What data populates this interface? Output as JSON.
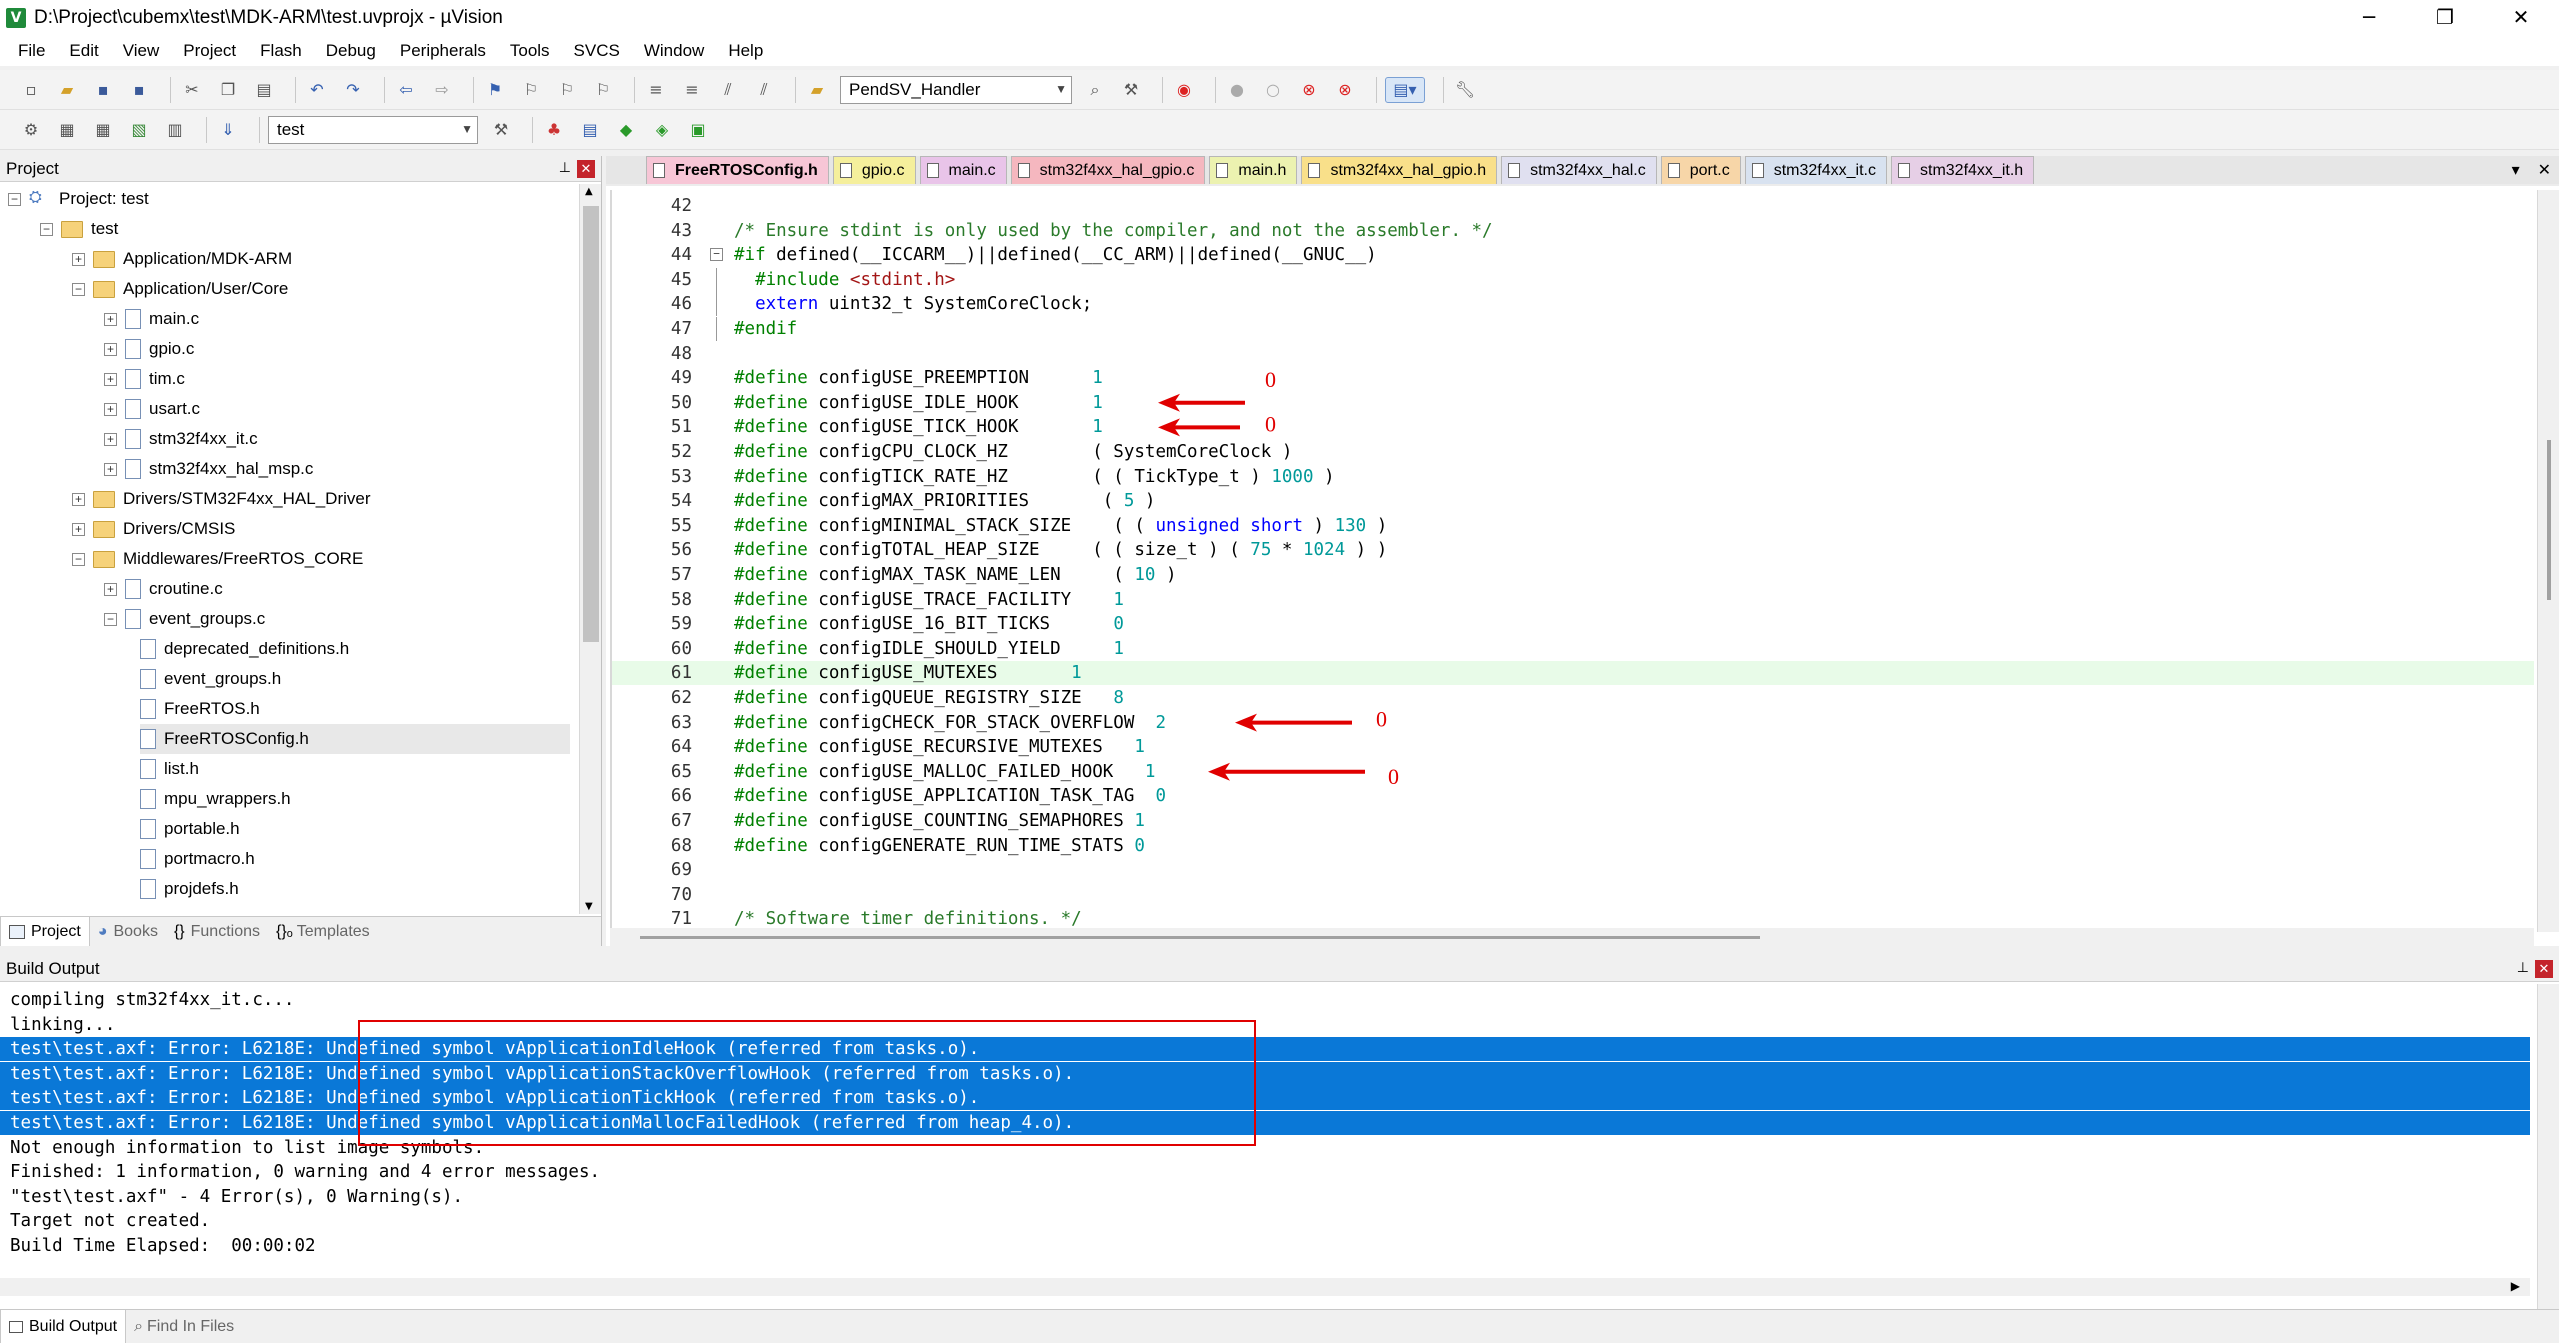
{
  "window": {
    "title": "D:\\Project\\cubemx\\test\\MDK-ARM\\test.uvprojx - µVision",
    "app_icon": "μVision-icon",
    "minimize": "─",
    "maximize": "❐",
    "close": "✕"
  },
  "menu": [
    "File",
    "Edit",
    "View",
    "Project",
    "Flash",
    "Debug",
    "Peripherals",
    "Tools",
    "SVCS",
    "Window",
    "Help"
  ],
  "toolbar1": {
    "function_combo": "PendSV_Handler"
  },
  "toolbar2": {
    "target_combo": "test"
  },
  "project_panel": {
    "title": "Project",
    "pin": "ᵖ",
    "close": "✕",
    "tree": [
      {
        "label": "Project: test",
        "indent": 0,
        "expander": "−",
        "icon": "project"
      },
      {
        "label": "test",
        "indent": 1,
        "expander": "−",
        "icon": "folder"
      },
      {
        "label": "Application/MDK-ARM",
        "indent": 2,
        "expander": "+",
        "icon": "folder"
      },
      {
        "label": "Application/User/Core",
        "indent": 2,
        "expander": "−",
        "icon": "folder"
      },
      {
        "label": "main.c",
        "indent": 3,
        "expander": "+",
        "icon": "file"
      },
      {
        "label": "gpio.c",
        "indent": 3,
        "expander": "+",
        "icon": "file"
      },
      {
        "label": "tim.c",
        "indent": 3,
        "expander": "+",
        "icon": "file"
      },
      {
        "label": "usart.c",
        "indent": 3,
        "expander": "+",
        "icon": "file"
      },
      {
        "label": "stm32f4xx_it.c",
        "indent": 3,
        "expander": "+",
        "icon": "file"
      },
      {
        "label": "stm32f4xx_hal_msp.c",
        "indent": 3,
        "expander": "+",
        "icon": "file"
      },
      {
        "label": "Drivers/STM32F4xx_HAL_Driver",
        "indent": 2,
        "expander": "+",
        "icon": "folder"
      },
      {
        "label": "Drivers/CMSIS",
        "indent": 2,
        "expander": "+",
        "icon": "folder"
      },
      {
        "label": "Middlewares/FreeRTOS_CORE",
        "indent": 2,
        "expander": "−",
        "icon": "folder"
      },
      {
        "label": "croutine.c",
        "indent": 3,
        "expander": "+",
        "icon": "file"
      },
      {
        "label": "event_groups.c",
        "indent": 3,
        "expander": "−",
        "icon": "file"
      },
      {
        "label": "deprecated_definitions.h",
        "indent": 4,
        "expander": "",
        "icon": "file"
      },
      {
        "label": "event_groups.h",
        "indent": 4,
        "expander": "",
        "icon": "file"
      },
      {
        "label": "FreeRTOS.h",
        "indent": 4,
        "expander": "",
        "icon": "file"
      },
      {
        "label": "FreeRTOSConfig.h",
        "indent": 4,
        "expander": "",
        "icon": "file",
        "selected": true
      },
      {
        "label": "list.h",
        "indent": 4,
        "expander": "",
        "icon": "file"
      },
      {
        "label": "mpu_wrappers.h",
        "indent": 4,
        "expander": "",
        "icon": "file"
      },
      {
        "label": "portable.h",
        "indent": 4,
        "expander": "",
        "icon": "file"
      },
      {
        "label": "portmacro.h",
        "indent": 4,
        "expander": "",
        "icon": "file"
      },
      {
        "label": "projdefs.h",
        "indent": 4,
        "expander": "",
        "icon": "file"
      }
    ],
    "tabs": [
      {
        "label": "Project",
        "icon": "project-tab-icon",
        "active": true
      },
      {
        "label": "Books",
        "icon": "books-icon"
      },
      {
        "label": "Functions",
        "icon": "{}"
      },
      {
        "label": "Templates",
        "icon": "{}ₒ"
      }
    ]
  },
  "editor": {
    "tabs": [
      {
        "label": "FreeRTOSConfig.h",
        "color": "#f7c6d6",
        "active": true
      },
      {
        "label": "gpio.c",
        "color": "#f5ef9c"
      },
      {
        "label": "main.c",
        "color": "#e9c4e9"
      },
      {
        "label": "stm32f4xx_hal_gpio.c",
        "color": "#f5b7bf"
      },
      {
        "label": "main.h",
        "color": "#ecf2b0"
      },
      {
        "label": "stm32f4xx_hal_gpio.h",
        "color": "#f9e08a"
      },
      {
        "label": "stm32f4xx_hal.c",
        "color": "#e0e0f0"
      },
      {
        "label": "port.c",
        "color": "#f7d6a8"
      },
      {
        "label": "stm32f4xx_it.c",
        "color": "#d8e2f0"
      },
      {
        "label": "stm32f4xx_it.h",
        "color": "#e6cfe6"
      }
    ],
    "tabs_menu": "▾",
    "tabs_close": "✕",
    "lines": [
      {
        "n": "42",
        "text": ""
      },
      {
        "n": "43",
        "text": "/* Ensure stdint is only used by the compiler, and not the assembler. */"
      },
      {
        "n": "44",
        "text": "#if defined(__ICCARM__)||defined(__CC_ARM)||defined(__GNUC__)",
        "fold": "−"
      },
      {
        "n": "45",
        "text": "  #include <stdint.h>"
      },
      {
        "n": "46",
        "text": "  extern uint32_t SystemCoreClock;"
      },
      {
        "n": "47",
        "text": "#endif"
      },
      {
        "n": "48",
        "text": ""
      },
      {
        "n": "49",
        "text": "#define configUSE_PREEMPTION      1"
      },
      {
        "n": "50",
        "text": "#define configUSE_IDLE_HOOK       1"
      },
      {
        "n": "51",
        "text": "#define configUSE_TICK_HOOK       1"
      },
      {
        "n": "52",
        "text": "#define configCPU_CLOCK_HZ        ( SystemCoreClock )"
      },
      {
        "n": "53",
        "text": "#define configTICK_RATE_HZ        ( ( TickType_t ) 1000 )"
      },
      {
        "n": "54",
        "text": "#define configMAX_PRIORITIES       ( 5 )"
      },
      {
        "n": "55",
        "text": "#define configMINIMAL_STACK_SIZE    ( ( unsigned short ) 130 )"
      },
      {
        "n": "56",
        "text": "#define configTOTAL_HEAP_SIZE     ( ( size_t ) ( 75 * 1024 ) )"
      },
      {
        "n": "57",
        "text": "#define configMAX_TASK_NAME_LEN     ( 10 )"
      },
      {
        "n": "58",
        "text": "#define configUSE_TRACE_FACILITY    1"
      },
      {
        "n": "59",
        "text": "#define configUSE_16_BIT_TICKS      0"
      },
      {
        "n": "60",
        "text": "#define configIDLE_SHOULD_YIELD     1"
      },
      {
        "n": "61",
        "text": "#define configUSE_MUTEXES       1",
        "highlight": true
      },
      {
        "n": "62",
        "text": "#define configQUEUE_REGISTRY_SIZE   8"
      },
      {
        "n": "63",
        "text": "#define configCHECK_FOR_STACK_OVERFLOW  2"
      },
      {
        "n": "64",
        "text": "#define configUSE_RECURSIVE_MUTEXES   1"
      },
      {
        "n": "65",
        "text": "#define configUSE_MALLOC_FAILED_HOOK   1"
      },
      {
        "n": "66",
        "text": "#define configUSE_APPLICATION_TASK_TAG  0"
      },
      {
        "n": "67",
        "text": "#define configUSE_COUNTING_SEMAPHORES 1"
      },
      {
        "n": "68",
        "text": "#define configGENERATE_RUN_TIME_STATS 0"
      },
      {
        "n": "69",
        "text": ""
      },
      {
        "n": "70",
        "text": ""
      },
      {
        "n": "71",
        "text": "/* Software timer definitions. */"
      }
    ],
    "annotations": [
      {
        "text": "0",
        "line": "50"
      },
      {
        "text": "0",
        "line": "51"
      },
      {
        "text": "0",
        "line": "63"
      },
      {
        "text": "0",
        "line": "65"
      }
    ]
  },
  "build_output": {
    "title": "Build Output",
    "pin": "ᵖ",
    "close": "✕",
    "lines": [
      {
        "text": "compiling stm32f4xx_it.c..."
      },
      {
        "text": "linking..."
      },
      {
        "text": "test\\test.axf: Error: L6218E: Undefined symbol vApplicationIdleHook (referred from tasks.o).",
        "selected": true
      },
      {
        "text": "test\\test.axf: Error: L6218E: Undefined symbol vApplicationStackOverflowHook (referred from tasks.o).",
        "selected": true
      },
      {
        "text": "test\\test.axf: Error: L6218E: Undefined symbol vApplicationTickHook (referred from tasks.o).",
        "selected": true
      },
      {
        "text": "test\\test.axf: Error: L6218E: Undefined symbol vApplicationMallocFailedHook (referred from heap_4.o).",
        "selected": true
      },
      {
        "text": "Not enough information to list image symbols."
      },
      {
        "text": "Finished: 1 information, 0 warning and 4 error messages."
      },
      {
        "text": "\"test\\test.axf\" - 4 Error(s), 0 Warning(s)."
      },
      {
        "text": "Target not created."
      },
      {
        "text": "Build Time Elapsed:  00:00:02"
      }
    ],
    "tabs": [
      {
        "label": "Build Output",
        "active": true
      },
      {
        "label": "Find In Files"
      }
    ]
  }
}
